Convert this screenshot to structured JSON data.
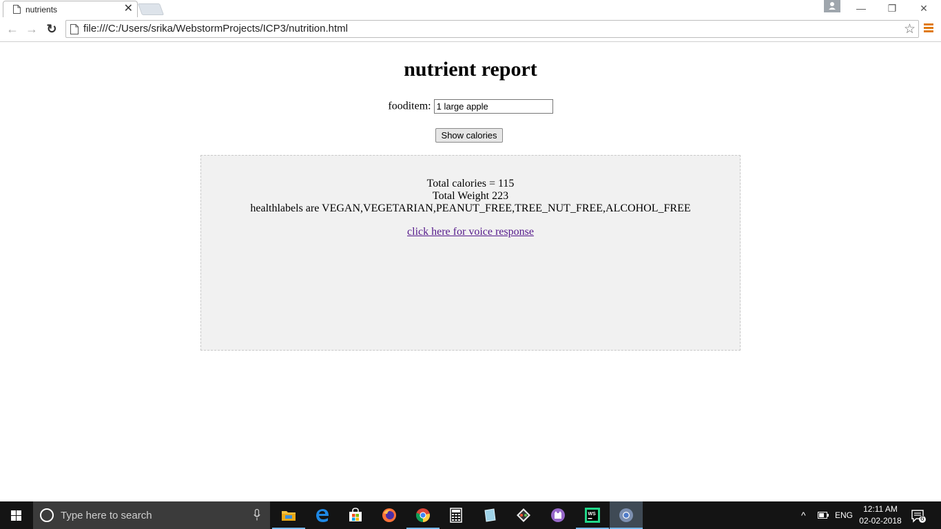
{
  "browser": {
    "tab_title": "nutrients",
    "tab_close": "✕",
    "address_url": "file:///C:/Users/srika/WebstormProjects/ICP3/nutrition.html",
    "star": "☆",
    "back": "←",
    "forward": "→",
    "reload": "↻",
    "minimize": "—",
    "restore": "❐",
    "close": "✕"
  },
  "page": {
    "title": "nutrient report",
    "food_label": "fooditem:",
    "food_value": "1 large apple",
    "show_button": "Show calories",
    "result": {
      "calories_line": "Total calories = 115",
      "weight_line": "Total Weight 223",
      "health_line": "healthlabels are VEGAN,VEGETARIAN,PEANUT_FREE,TREE_NUT_FREE,ALCOHOL_FREE",
      "voice_link": "click here for voice response"
    }
  },
  "taskbar": {
    "search_placeholder": "Type here to search",
    "language": "ENG",
    "time": "12:11 AM",
    "date": "02-02-2018",
    "notification_count": "6",
    "chevron": "^"
  },
  "colors": {
    "link_visited": "#551a8b",
    "result_bg": "#f1f1f1",
    "menu_accent": "#e07a10",
    "taskbar_bg": "#141414"
  },
  "icons": [
    "page-icon",
    "close-icon",
    "back-arrow-icon",
    "forward-arrow-icon",
    "reload-icon",
    "star-icon",
    "chrome-menu-icon",
    "windows-logo-icon",
    "cortana-icon",
    "microphone-icon",
    "file-explorer-icon",
    "edge-icon",
    "store-icon",
    "firefox-icon",
    "chrome-icon",
    "calculator-icon",
    "notepad-icon",
    "git-icon",
    "github-desktop-icon",
    "webstorm-icon",
    "battery-icon",
    "notification-icon"
  ]
}
